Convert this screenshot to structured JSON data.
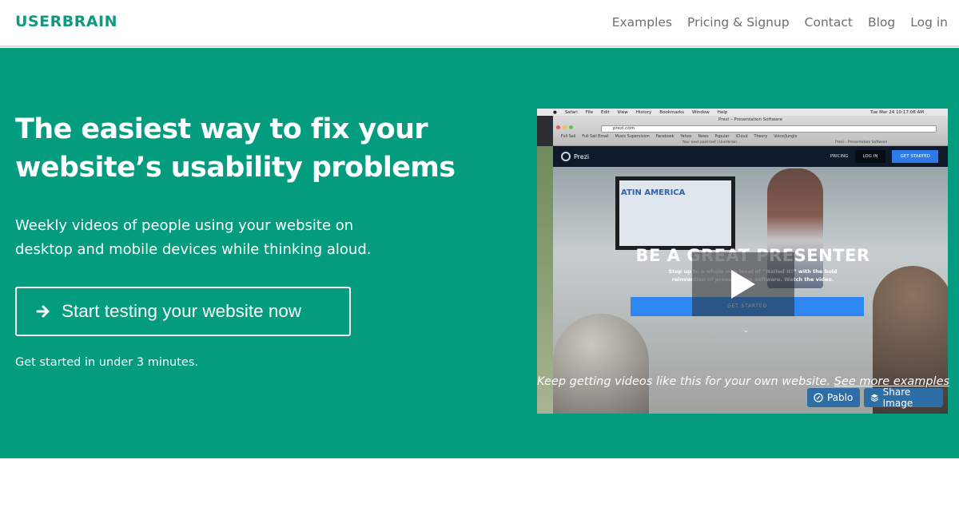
{
  "brand": {
    "logo": "USERBRAIN",
    "accent": "#039c7f",
    "logo_color": "#0c9b7e"
  },
  "nav": {
    "items": [
      "Examples",
      "Pricing & Signup",
      "Contact",
      "Blog",
      "Log in"
    ]
  },
  "hero": {
    "headline": "The easiest way to fix your website’s usability problems",
    "subtext": "Weekly videos of people using your website on desktop and mobile devices while thinking aloud.",
    "cta_label": "Start testing your website now",
    "cta_icon": "arrow-right-icon",
    "minor_text": "Get started in under 3 minutes."
  },
  "video": {
    "mac_menu": [
      "Safari",
      "File",
      "Edit",
      "View",
      "History",
      "Bookmarks",
      "Window",
      "Help"
    ],
    "clock": "Tue Mar 24  10:17:06 AM",
    "browser_title": "Prezi – Presentation Software",
    "url": "prezi.com",
    "bookmarks": [
      "Full Sail",
      "Full Sail Email",
      "Music Supervision",
      "Facebook",
      "Yahoo",
      "News",
      "Popular",
      "iCloud",
      "Theory",
      "Voice/Jungle"
    ],
    "tabs": [
      "Your next paid test | Userbrain",
      "Prezi – Presentation Software"
    ],
    "prezi": {
      "logo": "Prezi",
      "pricing": "PRICING",
      "login": "LOG IN",
      "get_started": "GET STARTED",
      "screen_text": "ATIN AMERICA",
      "big_headline": "BE A GREAT PRESENTER",
      "small_copy": "Step up to a whole new level of “Nailed it!” with the bold reinvention of presentation software. Watch the video.",
      "button": "GET STARTED"
    },
    "play_icon": "play-icon",
    "pablo_label": "Pablo",
    "share_label": "Share Image"
  },
  "caption": {
    "text": "Keep getting videos like this for your own website.",
    "link": "See more examples"
  }
}
